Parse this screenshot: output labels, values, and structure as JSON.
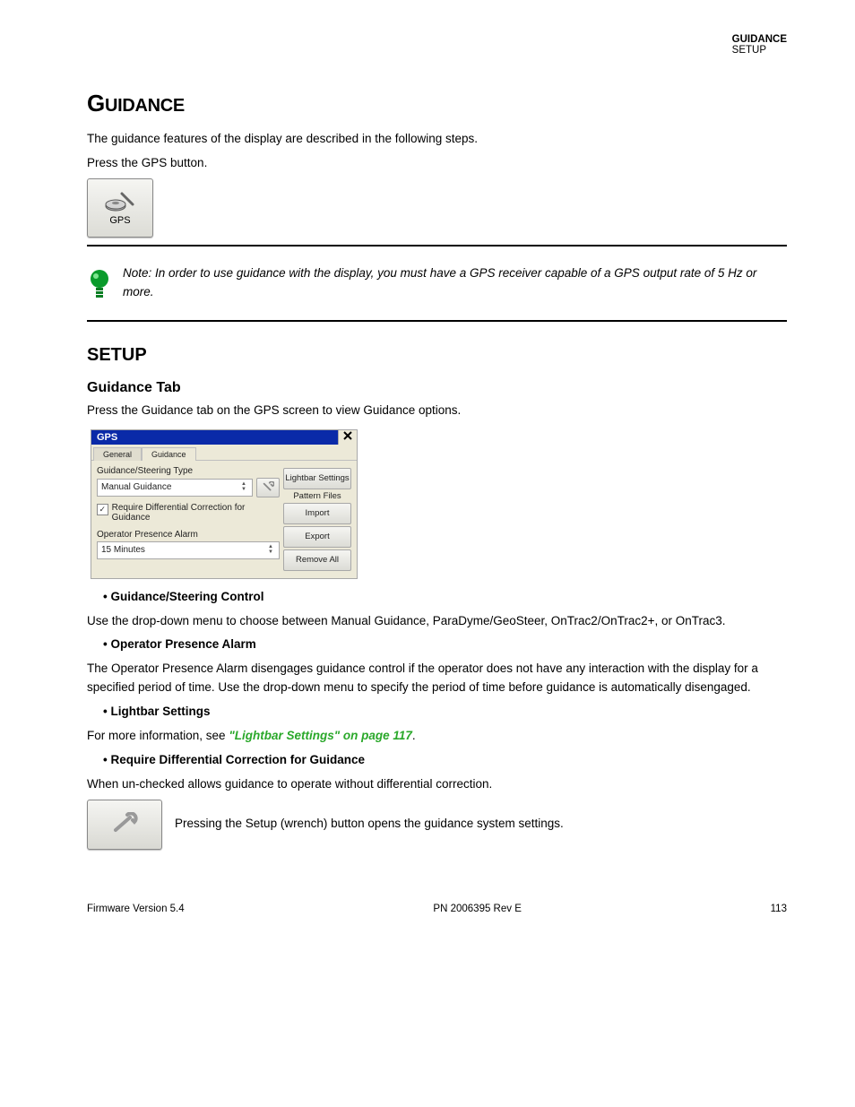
{
  "header_edge": {
    "title": "GUIDANCE",
    "subtitle": "Setup"
  },
  "h1_prefix": "G",
  "h1_rest": "UIDANCE",
  "intro1": "The guidance features of the display are described in the following steps.",
  "intro2": "Press the GPS button.",
  "gps_button_label": "GPS",
  "tip": "Note: In order to use guidance with the display, you must have a GPS receiver capable of a GPS output rate of 5 Hz or more.",
  "h2_setup": "SETUP",
  "h3_guidance_tab": "Guidance Tab",
  "setup_line": "Press the Guidance tab on the GPS screen to view Guidance options.",
  "dialog": {
    "title": "GPS",
    "tab_general": "General",
    "tab_guidance": "Guidance",
    "steering_label": "Guidance/Steering Type",
    "steering_value": "Manual Guidance",
    "require_diff": "Require Differential Correction for Guidance",
    "presence_label": "Operator Presence Alarm",
    "presence_value": "15 Minutes",
    "lightbar_btn": "Lightbar Settings",
    "pattern_files_label": "Pattern Files",
    "import_btn": "Import",
    "export_btn": "Export",
    "remove_btn": "Remove All"
  },
  "steering_title": "• Guidance/Steering Control",
  "steering_body": "Use the drop-down menu to choose between Manual Guidance, ParaDyme/GeoSteer, OnTrac2/OnTrac2+, or OnTrac3.",
  "adjust_line": "Pressing the Setup (wrench) button opens the guidance system settings.",
  "presence_title": "• Operator Presence Alarm",
  "presence_body": "The Operator Presence Alarm disengages guidance control if the operator does not have any interaction with the display for a specified period of time. Use the drop-down menu to specify the period of time before guidance is automatically disengaged.",
  "lightbar_title": "• Lightbar Settings",
  "lightbar_body_1": "For more information, see ",
  "lightbar_link": "\"Lightbar Settings\" on page 117",
  "lightbar_body_2": ".",
  "diff_title": "• Require Differential Correction for Guidance",
  "diff_body": "When un-checked allows guidance to operate without differential correction.",
  "footer": {
    "left": "Firmware Version 5.4",
    "mid": "PN 2006395 Rev E",
    "right": "113"
  }
}
